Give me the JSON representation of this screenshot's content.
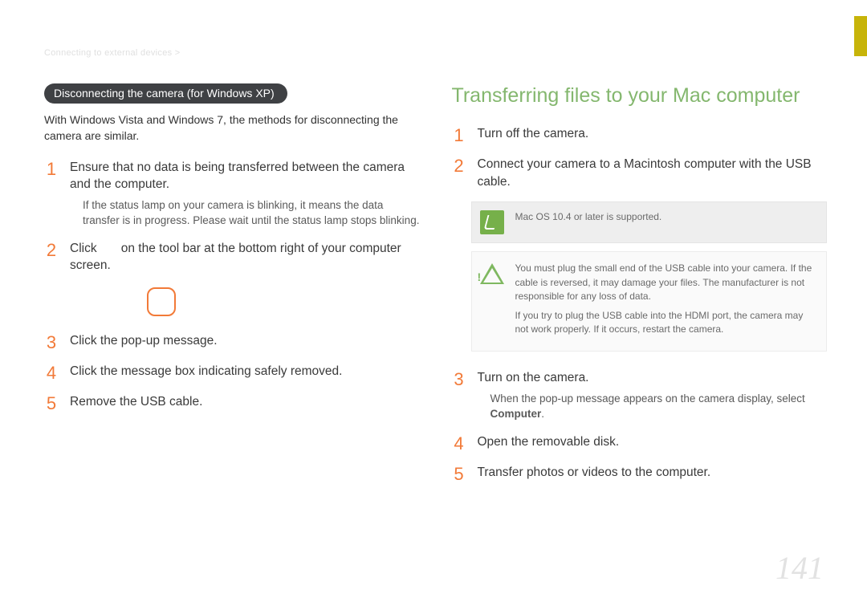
{
  "accent_orange": "#f27a38",
  "accent_green": "#84b76e",
  "breadcrumb": "Connecting to external devices >",
  "page_number": "141",
  "left": {
    "pill": "Disconnecting the camera (for Windows XP)",
    "intro": "With Windows Vista and Windows 7, the methods for disconnecting the camera are similar.",
    "steps": [
      {
        "n": "1",
        "text": "Ensure that no data is being transferred between the camera and the computer.",
        "sub": "If the status lamp on your camera is blinking, it means the data transfer is in progress. Please wait until the status lamp stops blinking."
      },
      {
        "n": "2",
        "text_prefix": "Click ",
        "text_suffix": " on the tool bar at the bottom right of your computer screen."
      },
      {
        "n": "3",
        "text": "Click the pop-up message."
      },
      {
        "n": "4",
        "text": "Click the message box indicating safely removed."
      },
      {
        "n": "5",
        "text": "Remove the USB cable."
      }
    ]
  },
  "right": {
    "heading": "Transferring files to your Mac computer",
    "steps_a": [
      {
        "n": "1",
        "text": "Turn off the camera."
      },
      {
        "n": "2",
        "text": "Connect your camera to a Macintosh computer with the USB cable."
      }
    ],
    "note": "Mac OS 10.4 or later is supported.",
    "warn1": "You must plug the small end of the USB cable into your camera. If the cable is reversed, it may damage your files. The manufacturer is not responsible for any loss of data.",
    "warn2": "If you try to plug the USB cable into the HDMI port, the camera may not work properly. If it occurs, restart the camera.",
    "steps_b": [
      {
        "n": "3",
        "text": "Turn on the camera.",
        "sub_prefix": "When the pop-up message appears on the camera display, select ",
        "sub_bold": "Computer",
        "sub_suffix": "."
      },
      {
        "n": "4",
        "text": "Open the removable disk."
      },
      {
        "n": "5",
        "text": "Transfer photos or videos to the computer."
      }
    ]
  }
}
